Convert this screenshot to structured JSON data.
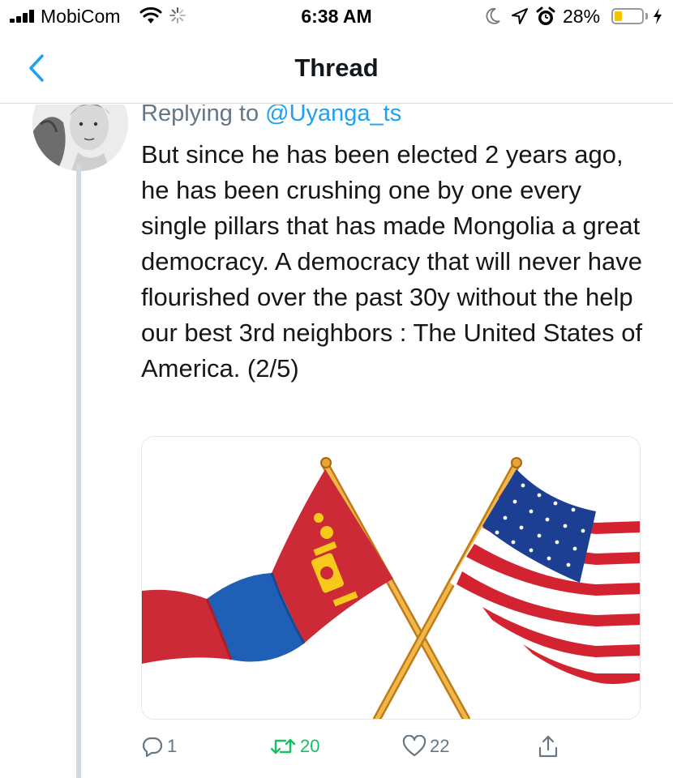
{
  "status_bar": {
    "carrier": "MobiCom",
    "time": "6:38 AM",
    "battery_percent": "28%",
    "battery_level": 0.28,
    "icons": [
      "signal-icon",
      "wifi-icon",
      "loading-spinner-icon",
      "moon-icon",
      "location-arrow-icon",
      "alarm-clock-icon",
      "battery-icon",
      "charging-bolt-icon"
    ]
  },
  "nav": {
    "title": "Thread",
    "back_icon": "chevron-left-icon"
  },
  "tweet": {
    "replying_prefix": "Replying to ",
    "replying_handle": "@Uyanga_ts",
    "text": "But since he has been elected 2 years ago, he has been crushing one by one every single pillars that has made Mongolia a great democracy. A democracy that will never have flourished over the past 30y without the help our best 3rd neighbors : The United States of America. (2/5)",
    "media": "crossed-flags-mongolia-usa-image",
    "actions": {
      "reply_count": "1",
      "retweet_count": "20",
      "like_count": "22"
    }
  },
  "colors": {
    "accent": "#1da1f2",
    "retweet": "#17bf63",
    "secondary_text": "#657786",
    "thread_line": "#cfd9de",
    "battery_fill": "#f4c300"
  }
}
